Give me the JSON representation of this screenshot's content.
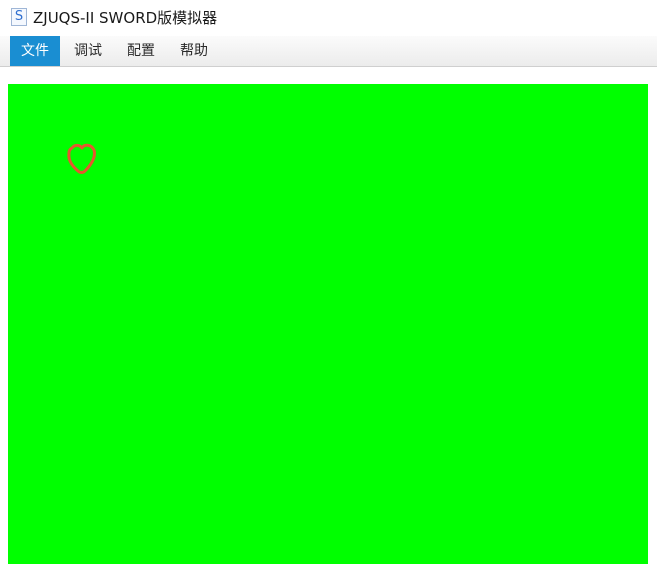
{
  "window": {
    "app_icon_letter": "S",
    "title": "ZJUQS-II SWORD版模拟器"
  },
  "menu": {
    "items": [
      {
        "label": "文件",
        "active": true
      },
      {
        "label": "调试",
        "active": false
      },
      {
        "label": "配置",
        "active": false
      },
      {
        "label": "帮助",
        "active": false
      }
    ]
  },
  "display": {
    "background_color": "#00ff00",
    "sprite_color": "#e4572e",
    "sprite_icon": "heart-outline-icon"
  }
}
